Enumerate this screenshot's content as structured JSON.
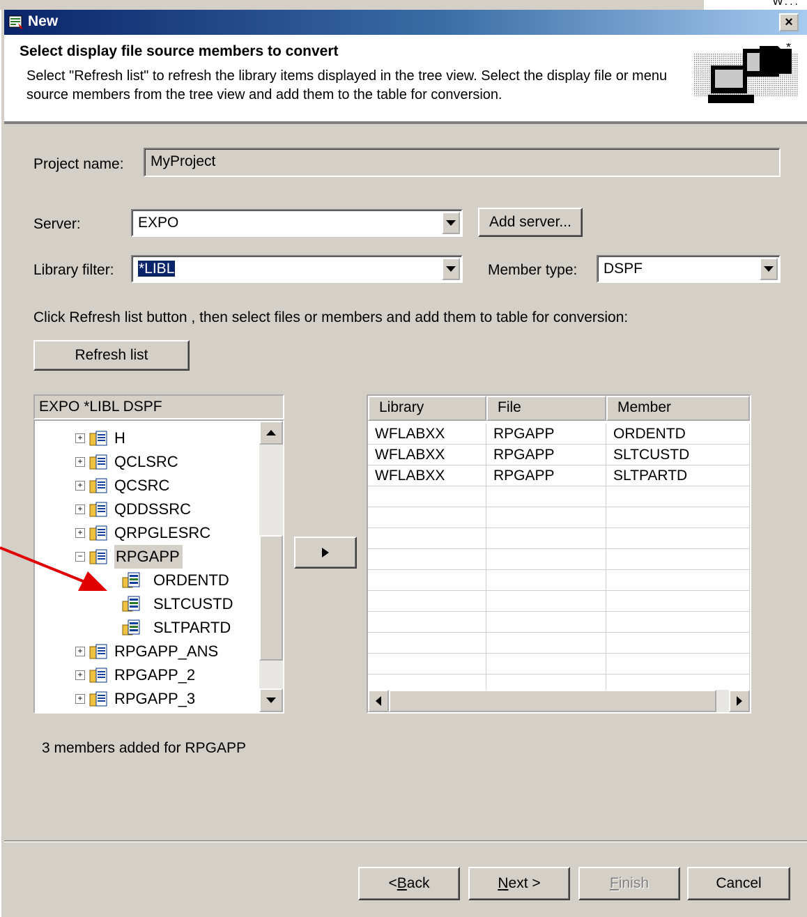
{
  "window": {
    "title": "New",
    "close_label": "×",
    "corner_fragment": "W..."
  },
  "header": {
    "title": "Select display file source members to convert",
    "description": "Select \"Refresh list\" to refresh the library items displayed in the tree view. Select the display file or menu source members from the tree view and add them to the table for conversion."
  },
  "form": {
    "project_name_label": "Project name:",
    "project_name_value": "MyProject",
    "server_label": "Server:",
    "server_value": "EXPO",
    "add_server_label": "Add server...",
    "library_filter_label": "Library filter:",
    "library_filter_value": "*LIBL",
    "member_type_label": "Member type:",
    "member_type_value": "DSPF",
    "instruction": "Click Refresh list button , then select files or members and add them to table for conversion:",
    "refresh_label": "Refresh list"
  },
  "tree": {
    "header": "EXPO *LIBL DSPF",
    "items": [
      {
        "label": "H",
        "type": "folder",
        "expanded": false
      },
      {
        "label": "QCLSRC",
        "type": "folder",
        "expanded": false
      },
      {
        "label": "QCSRC",
        "type": "folder",
        "expanded": false
      },
      {
        "label": "QDDSSRC",
        "type": "folder",
        "expanded": false
      },
      {
        "label": "QRPGLESRC",
        "type": "folder",
        "expanded": false
      },
      {
        "label": "RPGAPP",
        "type": "folder",
        "expanded": true,
        "selected": true
      },
      {
        "label": "ORDENTD",
        "type": "member"
      },
      {
        "label": "SLTCUSTD",
        "type": "member"
      },
      {
        "label": "SLTPARTD",
        "type": "member"
      },
      {
        "label": "RPGAPP_ANS",
        "type": "folder",
        "expanded": false
      },
      {
        "label": "RPGAPP_2",
        "type": "folder",
        "expanded": false
      },
      {
        "label": "RPGAPP_3",
        "type": "folder",
        "expanded": false
      }
    ]
  },
  "table": {
    "columns": [
      "Library",
      "File",
      "Member"
    ],
    "rows": [
      [
        "WFLABXX",
        "RPGAPP",
        "ORDENTD"
      ],
      [
        "WFLABXX",
        "RPGAPP",
        "SLTCUSTD"
      ],
      [
        "WFLABXX",
        "RPGAPP",
        "SLTPARTD"
      ]
    ]
  },
  "status": "3 members added for RPGAPP",
  "buttons": {
    "back_prefix": "< ",
    "back_key": "B",
    "back_rest": "ack",
    "next_key": "N",
    "next_rest": "ext >",
    "finish_key": "F",
    "finish_rest": "inish",
    "cancel": "Cancel"
  },
  "colors": {
    "title_bar": "#0a246a",
    "dialog_bg": "#d4d0c8",
    "annotation_arrow": "#e00000",
    "selection": "#0a246a"
  }
}
